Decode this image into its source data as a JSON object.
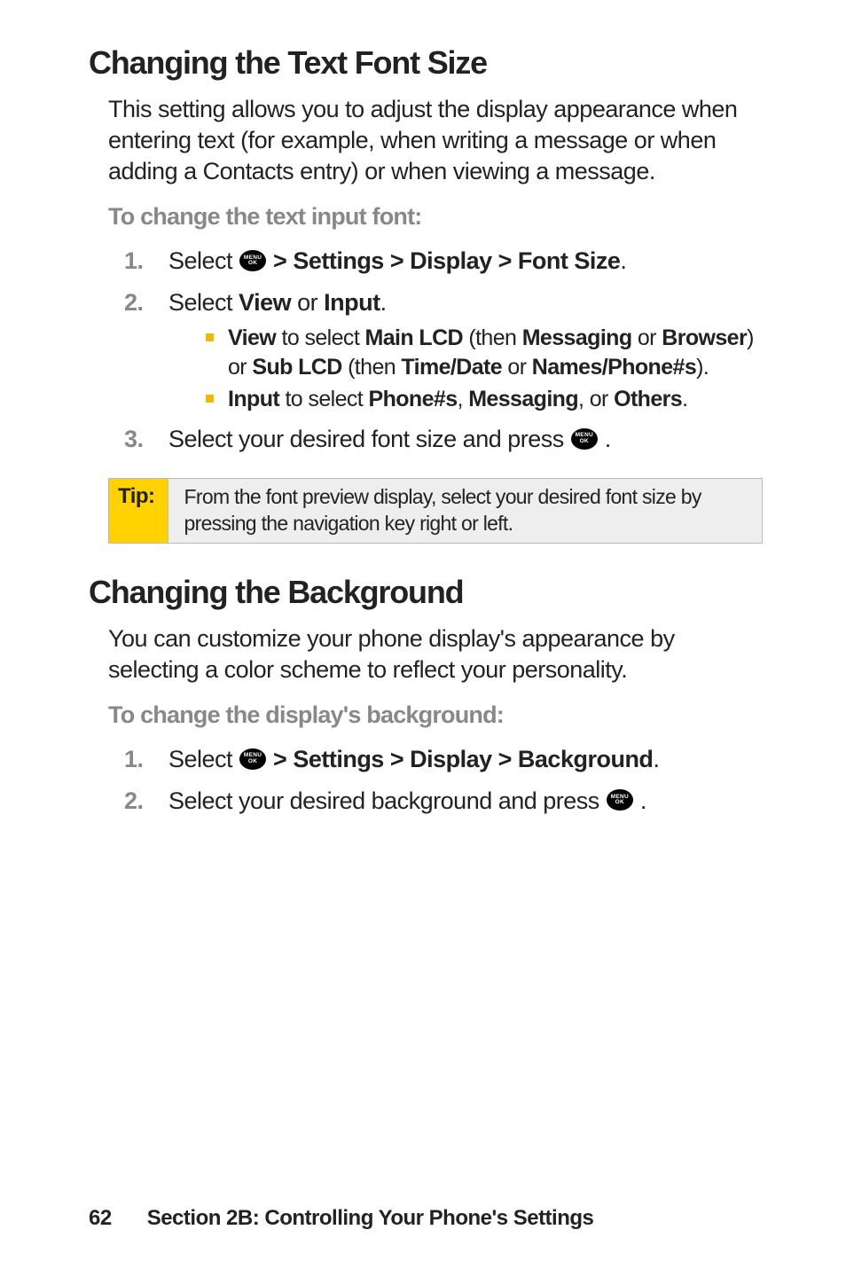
{
  "section1": {
    "heading": "Changing the Text Font Size",
    "intro": "This setting allows you to adjust the display appearance when entering text (for example, when writing a message or when adding a Contacts entry) or when viewing a message.",
    "subheading": "To change the text input font:",
    "step1_prefix": "Select ",
    "step1_suffix": " > Settings > Display > Font Size",
    "step2_part1": "Select ",
    "step2_bold1": "View",
    "step2_part2": " or ",
    "step2_bold2": "Input",
    "step2_part3": ".",
    "sub1_b1": "View",
    "sub1_t1": " to select ",
    "sub1_b2": "Main LCD",
    "sub1_t2": " (then ",
    "sub1_b3": "Messaging",
    "sub1_t3": " or ",
    "sub1_b4": "Browser",
    "sub1_t4": ") or ",
    "sub1_b5": "Sub LCD",
    "sub1_t5": " (then ",
    "sub1_b6": "Time/Date",
    "sub1_t6": " or ",
    "sub1_b7": "Names/Phone#s",
    "sub1_t7": ").",
    "sub2_b1": "Input",
    "sub2_t1": " to select ",
    "sub2_b2": "Phone#s",
    "sub2_t2": ", ",
    "sub2_b3": "Messaging",
    "sub2_t3": ", or ",
    "sub2_b4": "Others",
    "sub2_t4": ".",
    "step3_text": "Select your desired font size and press ",
    "step3_suffix": " .",
    "tip_label": "Tip:",
    "tip_content": "From the font preview display, select your desired font size by pressing the navigation key right or left."
  },
  "section2": {
    "heading": "Changing the Background",
    "intro": "You can customize your phone display's appearance by selecting a color scheme to reflect your personality.",
    "subheading": "To change the display's background:",
    "step1_prefix": "Select ",
    "step1_suffix": " > Settings > Display > Background",
    "step2_text": "Select your desired background and press ",
    "step2_suffix": " ."
  },
  "icon": {
    "line1": "MENU",
    "line2": "OK"
  },
  "footer": {
    "page": "62",
    "text": "Section 2B: Controlling Your Phone's Settings"
  }
}
